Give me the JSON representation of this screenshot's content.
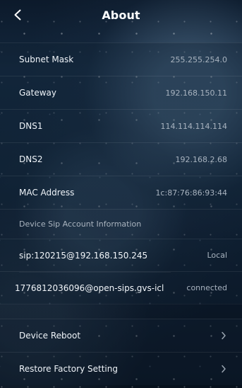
{
  "header": {
    "title": "About"
  },
  "details": [
    {
      "label": "Subnet Mask",
      "value": "255.255.254.0"
    },
    {
      "label": "Gateway",
      "value": "192.168.150.11"
    },
    {
      "label": "DNS1",
      "value": "114.114.114.114"
    },
    {
      "label": "DNS2",
      "value": "192.168.2.68"
    },
    {
      "label": "MAC Address",
      "value": "1c:87:76:86:93:44"
    }
  ],
  "account_section": {
    "title": "Device Sip Account Information",
    "accounts": [
      {
        "address": "sip:120215@192.168.150.245",
        "status": "Local"
      },
      {
        "address": "1776812036096@open-sips.gvs-icl",
        "status": "connected"
      }
    ]
  },
  "actions": [
    {
      "label": "Device Reboot"
    },
    {
      "label": "Restore Factory Setting"
    }
  ],
  "icons": {
    "back": "chevron-left-icon",
    "row_chevron": "chevron-right-icon"
  },
  "colors": {
    "background": "#0f2236",
    "text_primary": "#eef3f8",
    "text_secondary": "#a8b3bf",
    "divider": "#1f2f43"
  }
}
